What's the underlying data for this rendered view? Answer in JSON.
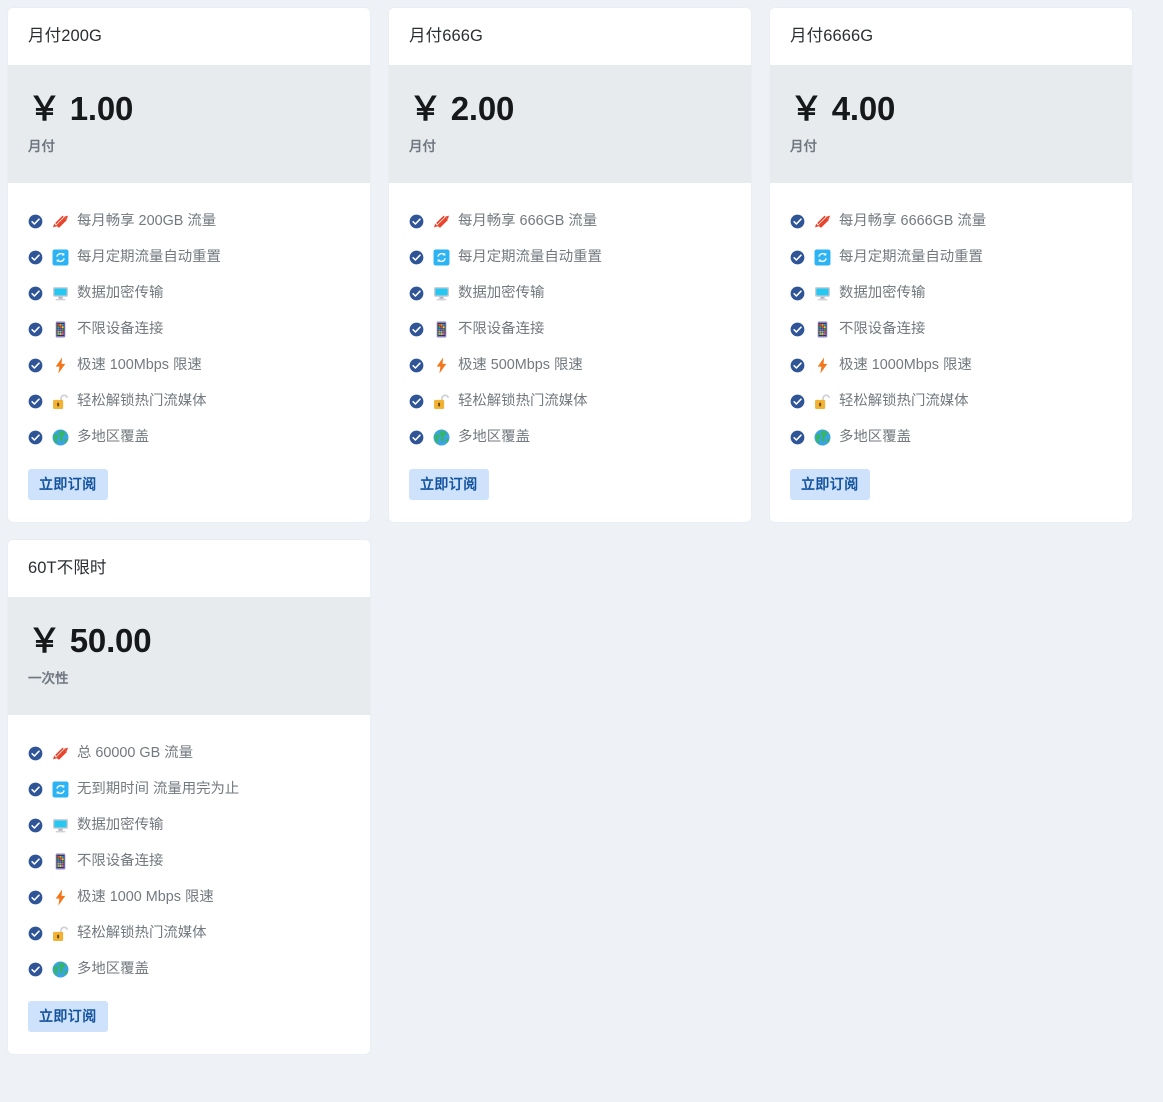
{
  "theme": {
    "page_background": "#eef1f6",
    "card_background": "#ffffff",
    "price_header_background": "#e8ebee",
    "button_background": "#cfe2fb",
    "button_text_color": "#12529f",
    "check_icon_color": "#2f5597",
    "feature_text_color": "#73797f",
    "title_color": "#2b2f33"
  },
  "plans": [
    {
      "title": "月付200G",
      "price": "￥ 1.00",
      "currency": "￥",
      "amount": "1.00",
      "period": "月付",
      "button_label": "立即订阅",
      "features": [
        {
          "icon": "candy-icon",
          "label": "每月畅享 200GB 流量"
        },
        {
          "icon": "refresh-icon",
          "label": "每月定期流量自动重置"
        },
        {
          "icon": "monitor-icon",
          "label": "数据加密传输"
        },
        {
          "icon": "device-icon",
          "label": "不限设备连接"
        },
        {
          "icon": "lightning-icon",
          "label": "极速 100Mbps 限速"
        },
        {
          "icon": "unlock-icon",
          "label": "轻松解锁热门流媒体"
        },
        {
          "icon": "globe-icon",
          "label": "多地区覆盖"
        }
      ]
    },
    {
      "title": "月付666G",
      "price": "￥ 2.00",
      "currency": "￥",
      "amount": "2.00",
      "period": "月付",
      "button_label": "立即订阅",
      "features": [
        {
          "icon": "candy-icon",
          "label": "每月畅享 666GB 流量"
        },
        {
          "icon": "refresh-icon",
          "label": "每月定期流量自动重置"
        },
        {
          "icon": "monitor-icon",
          "label": "数据加密传输"
        },
        {
          "icon": "device-icon",
          "label": "不限设备连接"
        },
        {
          "icon": "lightning-icon",
          "label": "极速 500Mbps 限速"
        },
        {
          "icon": "unlock-icon",
          "label": "轻松解锁热门流媒体"
        },
        {
          "icon": "globe-icon",
          "label": "多地区覆盖"
        }
      ]
    },
    {
      "title": "月付6666G",
      "price": "￥ 4.00",
      "currency": "￥",
      "amount": "4.00",
      "period": "月付",
      "button_label": "立即订阅",
      "features": [
        {
          "icon": "candy-icon",
          "label": "每月畅享 6666GB 流量"
        },
        {
          "icon": "refresh-icon",
          "label": "每月定期流量自动重置"
        },
        {
          "icon": "monitor-icon",
          "label": "数据加密传输"
        },
        {
          "icon": "device-icon",
          "label": "不限设备连接"
        },
        {
          "icon": "lightning-icon",
          "label": "极速 1000Mbps 限速"
        },
        {
          "icon": "unlock-icon",
          "label": "轻松解锁热门流媒体"
        },
        {
          "icon": "globe-icon",
          "label": "多地区覆盖"
        }
      ]
    },
    {
      "title": "60T不限时",
      "price": "￥ 50.00",
      "currency": "￥",
      "amount": "50.00",
      "period": "一次性",
      "button_label": "立即订阅",
      "features": [
        {
          "icon": "candy-icon",
          "label": "总 60000 GB 流量"
        },
        {
          "icon": "refresh-icon",
          "label": "无到期时间 流量用完为止"
        },
        {
          "icon": "monitor-icon",
          "label": "数据加密传输"
        },
        {
          "icon": "device-icon",
          "label": "不限设备连接"
        },
        {
          "icon": "lightning-icon",
          "label": "极速 1000 Mbps 限速"
        },
        {
          "icon": "unlock-icon",
          "label": "轻松解锁热门流媒体"
        },
        {
          "icon": "globe-icon",
          "label": "多地区覆盖"
        }
      ]
    }
  ]
}
